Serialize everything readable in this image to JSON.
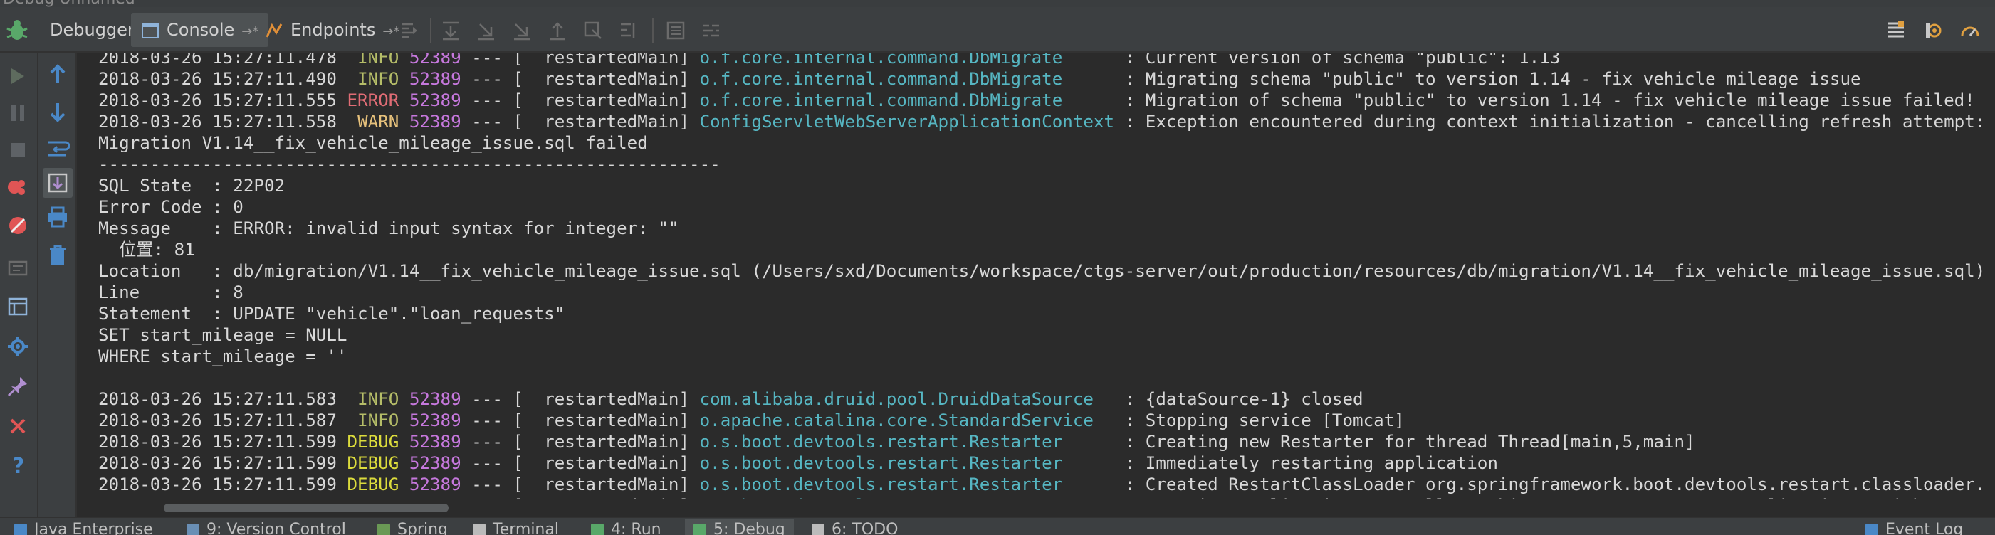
{
  "window": {
    "title": "Debug   Unnamed"
  },
  "toolbar": {
    "tabs": [
      {
        "label": "Debugger"
      },
      {
        "label": "Console",
        "arrow": "→*"
      },
      {
        "label": "Endpoints",
        "arrow": "→*"
      }
    ]
  },
  "console": {
    "lines": [
      [
        {
          "t": "2018-03-26 15:27:11.478  "
        },
        {
          "t": "INFO",
          "c": "INFO"
        },
        {
          "t": " "
        },
        {
          "t": "52389",
          "c": "pid"
        },
        {
          "t": " --- [  restartedMain] "
        },
        {
          "t": "o.f.core.internal.command.DbMigrate     ",
          "c": "logger"
        },
        {
          "t": " : Current version of schema \"public\": 1.13"
        }
      ],
      [
        {
          "t": "2018-03-26 15:27:11.490  "
        },
        {
          "t": "INFO",
          "c": "INFO"
        },
        {
          "t": " "
        },
        {
          "t": "52389",
          "c": "pid"
        },
        {
          "t": " --- [  restartedMain] "
        },
        {
          "t": "o.f.core.internal.command.DbMigrate     ",
          "c": "logger"
        },
        {
          "t": " : Migrating schema \"public\" to version 1.14 - fix vehicle mileage issue"
        }
      ],
      [
        {
          "t": "2018-03-26 15:27:11.555 "
        },
        {
          "t": "ERROR",
          "c": "ERROR"
        },
        {
          "t": " "
        },
        {
          "t": "52389",
          "c": "pid"
        },
        {
          "t": " --- [  restartedMain] "
        },
        {
          "t": "o.f.core.internal.command.DbMigrate     ",
          "c": "logger"
        },
        {
          "t": " : Migration of schema \"public\" to version 1.14 - fix vehicle mileage issue failed! Changes"
        }
      ],
      [
        {
          "t": "2018-03-26 15:27:11.558  "
        },
        {
          "t": "WARN",
          "c": "WARN"
        },
        {
          "t": " "
        },
        {
          "t": "52389",
          "c": "pid"
        },
        {
          "t": " --- [  restartedMain] "
        },
        {
          "t": "ConfigServletWebServerApplicationContext",
          "c": "logger"
        },
        {
          "t": " : Exception encountered during context initialization - cancelling refresh attempt: org.spr"
        }
      ],
      [
        {
          "t": "Migration V1.14__fix_vehicle_mileage_issue.sql failed"
        }
      ],
      [
        {
          "t": "------------------------------------------------------------"
        }
      ],
      [
        {
          "t": "SQL State  : 22P02"
        }
      ],
      [
        {
          "t": "Error Code : 0"
        }
      ],
      [
        {
          "t": "Message    : ERROR: invalid input syntax for integer: \"\""
        }
      ],
      [
        {
          "t": "  位置: 81"
        }
      ],
      [
        {
          "t": "Location   : db/migration/V1.14__fix_vehicle_mileage_issue.sql (/Users/sxd/Documents/workspace/ctgs-server/out/production/resources/db/migration/V1.14__fix_vehicle_mileage_issue.sql)"
        }
      ],
      [
        {
          "t": "Line       : 8"
        }
      ],
      [
        {
          "t": "Statement  : UPDATE \"vehicle\".\"loan_requests\""
        }
      ],
      [
        {
          "t": "SET start_mileage = NULL"
        }
      ],
      [
        {
          "t": "WHERE start_mileage = ''"
        }
      ],
      [
        {
          "t": " "
        }
      ],
      [
        {
          "t": "2018-03-26 15:27:11.583  "
        },
        {
          "t": "INFO",
          "c": "INFO"
        },
        {
          "t": " "
        },
        {
          "t": "52389",
          "c": "pid"
        },
        {
          "t": " --- [  restartedMain] "
        },
        {
          "t": "com.alibaba.druid.pool.DruidDataSource  ",
          "c": "logger"
        },
        {
          "t": " : {dataSource-1} closed"
        }
      ],
      [
        {
          "t": "2018-03-26 15:27:11.587  "
        },
        {
          "t": "INFO",
          "c": "INFO"
        },
        {
          "t": " "
        },
        {
          "t": "52389",
          "c": "pid"
        },
        {
          "t": " --- [  restartedMain] "
        },
        {
          "t": "o.apache.catalina.core.StandardService  ",
          "c": "logger"
        },
        {
          "t": " : Stopping service [Tomcat]"
        }
      ],
      [
        {
          "t": "2018-03-26 15:27:11.599 "
        },
        {
          "t": "DEBUG",
          "c": "DEBUG"
        },
        {
          "t": " "
        },
        {
          "t": "52389",
          "c": "pid"
        },
        {
          "t": " --- [  restartedMain] "
        },
        {
          "t": "o.s.boot.devtools.restart.Restarter     ",
          "c": "logger"
        },
        {
          "t": " : Creating new Restarter for thread Thread[main,5,main]"
        }
      ],
      [
        {
          "t": "2018-03-26 15:27:11.599 "
        },
        {
          "t": "DEBUG",
          "c": "DEBUG"
        },
        {
          "t": " "
        },
        {
          "t": "52389",
          "c": "pid"
        },
        {
          "t": " --- [  restartedMain] "
        },
        {
          "t": "o.s.boot.devtools.restart.Restarter     ",
          "c": "logger"
        },
        {
          "t": " : Immediately restarting application"
        }
      ],
      [
        {
          "t": "2018-03-26 15:27:11.599 "
        },
        {
          "t": "DEBUG",
          "c": "DEBUG"
        },
        {
          "t": " "
        },
        {
          "t": "52389",
          "c": "pid"
        },
        {
          "t": " --- [  restartedMain] "
        },
        {
          "t": "o.s.boot.devtools.restart.Restarter     ",
          "c": "logger"
        },
        {
          "t": " : Created RestartClassLoader org.springframework.boot.devtools.restart.classloader.RestartC"
        }
      ],
      [
        {
          "t": "2018-03-26 15:27:11.599 "
        },
        {
          "t": "DEBUG",
          "c": "DEBUG"
        },
        {
          "t": " "
        },
        {
          "t": "52389",
          "c": "pid"
        },
        {
          "t": " --- [  restartedMain] "
        },
        {
          "t": "o.s.boot.devtools.restart.Restarter     ",
          "c": "logger"
        },
        {
          "t": " : Starting application com.gallery.chipatrorg.server.ServerApplicationKt with URLs [file:/"
        }
      ]
    ]
  },
  "statusbar": {
    "items": [
      {
        "label": "Java Enterprise",
        "color": "#4a88c7"
      },
      {
        "label": "9: Version Control",
        "color": "#6a8fb5"
      },
      {
        "label": "Spring",
        "color": "#6a9955"
      },
      {
        "label": "Terminal",
        "color": "#bbbbbb"
      },
      {
        "label": "4: Run",
        "color": "#59a869"
      },
      {
        "label": "5: Debug",
        "color": "#59a869"
      },
      {
        "label": "6: TODO",
        "color": "#bbbbbb"
      },
      {
        "label": "Event Log",
        "color": "#4a88c7"
      }
    ]
  },
  "colors": {
    "info": "#b5bd68",
    "error": "#e06c75",
    "warn": "#e5c07b",
    "debug": "#dcdc3c",
    "pid": "#c678dd",
    "logger": "#56b6c2"
  }
}
